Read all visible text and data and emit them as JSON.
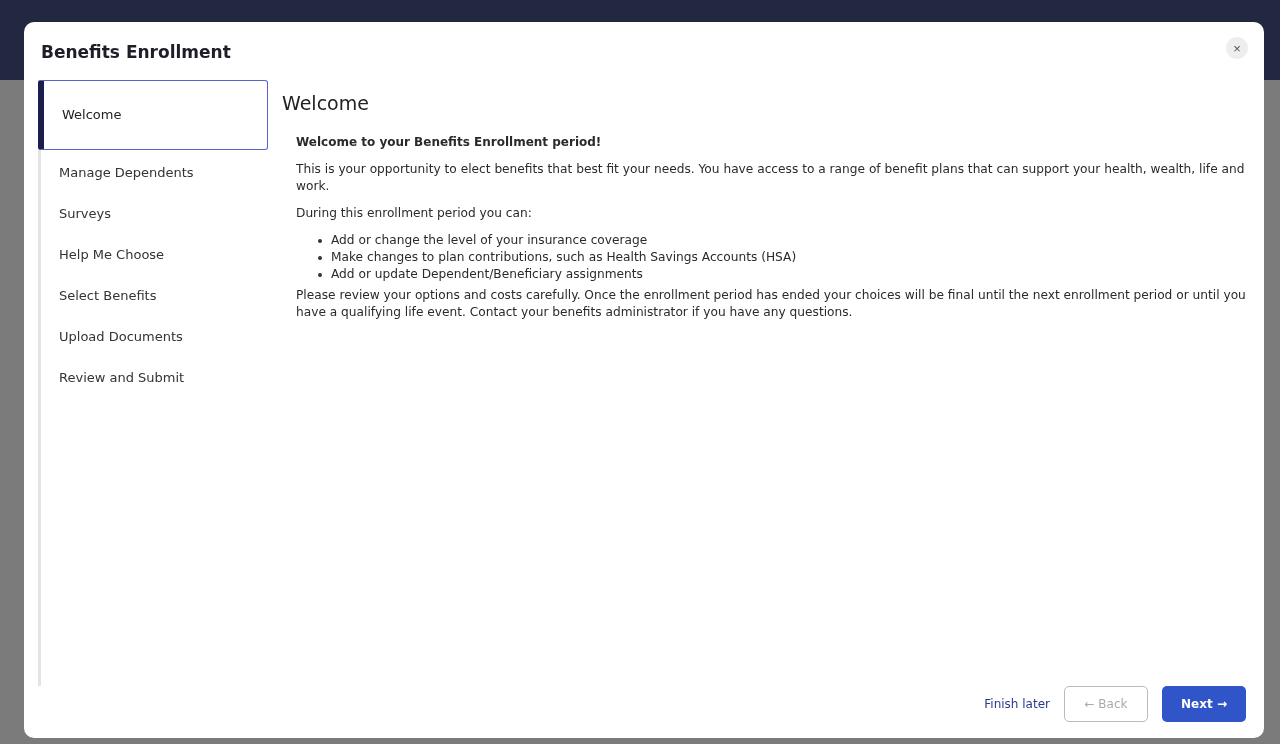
{
  "dialog": {
    "title": "Benefits Enrollment",
    "close": "×"
  },
  "steps": [
    {
      "label": "Welcome",
      "selected": true
    },
    {
      "label": "Manage Dependents",
      "selected": false
    },
    {
      "label": "Surveys",
      "selected": false
    },
    {
      "label": "Help Me Choose",
      "selected": false
    },
    {
      "label": "Select Benefits",
      "selected": false
    },
    {
      "label": "Upload Documents",
      "selected": false
    },
    {
      "label": "Review and Submit",
      "selected": false
    }
  ],
  "content": {
    "heading": "Welcome",
    "intro": "Welcome to your Benefits Enrollment period!",
    "paragraph": "This is your opportunity to elect benefits that best fit your needs. You have access to a range of benefit plans that can support your health, wealth, life and work.",
    "lead": "During this enrollment period you can:",
    "bullets": [
      "Add or change the level of your insurance coverage",
      "Make changes to plan contributions, such as Health Savings Accounts (HSA)",
      "Add or update Dependent/Beneficiary assignments"
    ],
    "closing": "Please review your options and costs carefully. Once the enrollment period has ended your choices will be final until the next enrollment period or until you have a qualifying life event. Contact your benefits administrator if you have any questions."
  },
  "footer": {
    "finish_later": "Finish later",
    "back": {
      "label": "← Back",
      "disabled": true
    },
    "next": {
      "label": "Next →",
      "disabled": false
    }
  }
}
